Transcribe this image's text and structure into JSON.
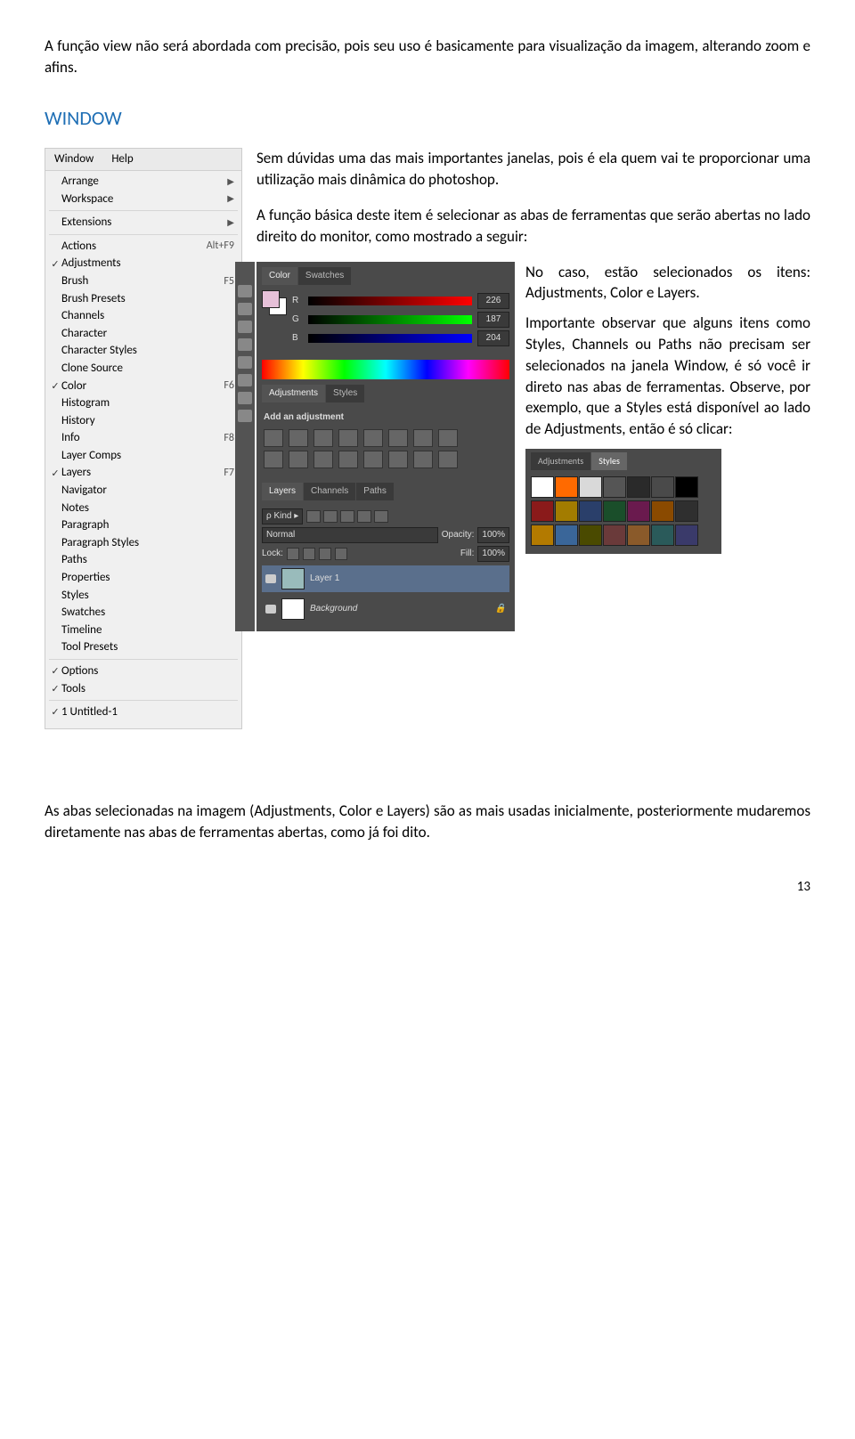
{
  "intro_paragraph": "A função view não será abordada com precisão, pois seu uso é basicamente para visualização da imagem, alterando zoom e afins.",
  "section_title": "WINDOW",
  "menu": {
    "tabs": [
      "Window",
      "Help"
    ],
    "items": [
      {
        "label": "Arrange",
        "sub": true
      },
      {
        "label": "Workspace",
        "sub": true
      },
      "sep",
      {
        "label": "Extensions",
        "sub": true
      },
      "sep",
      {
        "label": "Actions",
        "short": "Alt+F9"
      },
      {
        "label": "Adjustments",
        "check": true
      },
      {
        "label": "Brush",
        "short": "F5"
      },
      {
        "label": "Brush Presets"
      },
      {
        "label": "Channels"
      },
      {
        "label": "Character"
      },
      {
        "label": "Character Styles"
      },
      {
        "label": "Clone Source"
      },
      {
        "label": "Color",
        "check": true,
        "short": "F6"
      },
      {
        "label": "Histogram"
      },
      {
        "label": "History"
      },
      {
        "label": "Info",
        "short": "F8"
      },
      {
        "label": "Layer Comps"
      },
      {
        "label": "Layers",
        "check": true,
        "short": "F7"
      },
      {
        "label": "Navigator"
      },
      {
        "label": "Notes"
      },
      {
        "label": "Paragraph"
      },
      {
        "label": "Paragraph Styles"
      },
      {
        "label": "Paths"
      },
      {
        "label": "Properties"
      },
      {
        "label": "Styles"
      },
      {
        "label": "Swatches"
      },
      {
        "label": "Timeline"
      },
      {
        "label": "Tool Presets"
      },
      "sep",
      {
        "label": "Options",
        "check": true
      },
      {
        "label": "Tools",
        "check": true
      },
      "sep",
      {
        "label": "1 Untitled-1",
        "check": true
      }
    ]
  },
  "right_p1": "Sem dúvidas uma das mais importantes janelas, pois é ela quem vai te proporcionar uma utilização mais dinâmica do photoshop.",
  "right_p2": "A função básica deste item é selecionar as abas de ferramentas que serão abertas no lado direito do monitor, como mostrado a seguir:",
  "panel_tabs": {
    "color": "Color",
    "swatches": "Swatches",
    "adjustments": "Adjustments",
    "styles": "Styles",
    "layers": "Layers",
    "channels": "Channels",
    "paths": "Paths"
  },
  "color": {
    "r": "226",
    "g": "187",
    "b": "204",
    "labels": {
      "r": "R",
      "g": "G",
      "b": "B"
    }
  },
  "adjust_label": "Add an adjustment",
  "layers": {
    "kind": "Kind",
    "normal": "Normal",
    "opacity_l": "Opacity:",
    "opacity_v": "100%",
    "lock": "Lock:",
    "fill_l": "Fill:",
    "fill_v": "100%",
    "layer1": "Layer 1",
    "background": "Background"
  },
  "side_p1": "No caso, estão selecionados os itens: Adjustments, Color e Layers.",
  "side_p2": "Importante observar que alguns itens como Styles, Channels ou Paths não precisam ser selecionados na janela Window, é só você ir direto nas abas de ferramentas. Observe, por exemplo, que a Styles está disponível ao lado de Adjustments, então é só clicar:",
  "styles_colors": [
    "#ffffff",
    "#ff6a00",
    "#d9d9d9",
    "#555555",
    "#2a2a2a",
    "#4a4a4a",
    "#000000",
    "#8a1a1a",
    "#a37c00",
    "#2a3f6a",
    "#1a4e2a",
    "#6a1a4e",
    "#8a4a00",
    "#2f2f2f",
    "#b37a00",
    "#3a6699",
    "#4a4a00",
    "#6a3a3a",
    "#8a5a2a",
    "#2a5a5a",
    "#3a3a6a"
  ],
  "bottom_paragraph": "As abas selecionadas na imagem (Adjustments, Color e Layers) são as mais usadas inicialmente, posteriormente mudaremos diretamente nas abas de ferramentas abertas, como já foi dito.",
  "page_number": "13"
}
